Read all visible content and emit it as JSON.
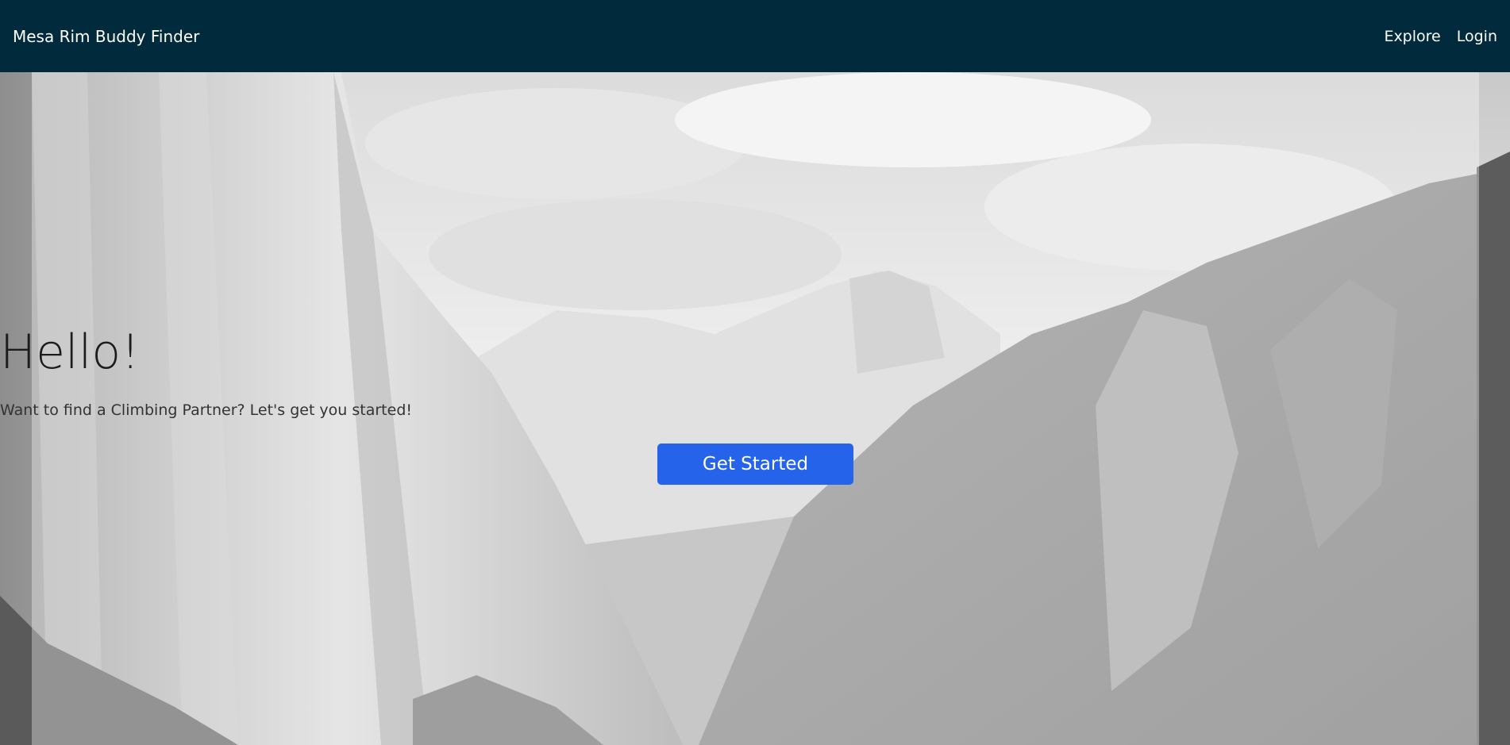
{
  "navbar": {
    "brand": "Mesa Rim Buddy Finder",
    "links": [
      {
        "label": "Explore"
      },
      {
        "label": "Login"
      }
    ],
    "background": "#012a3c"
  },
  "hero": {
    "title": "Hello!",
    "subtitle": "Want to find a Climbing Partner? Let's get you started!",
    "cta_label": "Get Started",
    "cta_color": "#2563eb",
    "background_image": "grayscale mountain valley photo"
  }
}
